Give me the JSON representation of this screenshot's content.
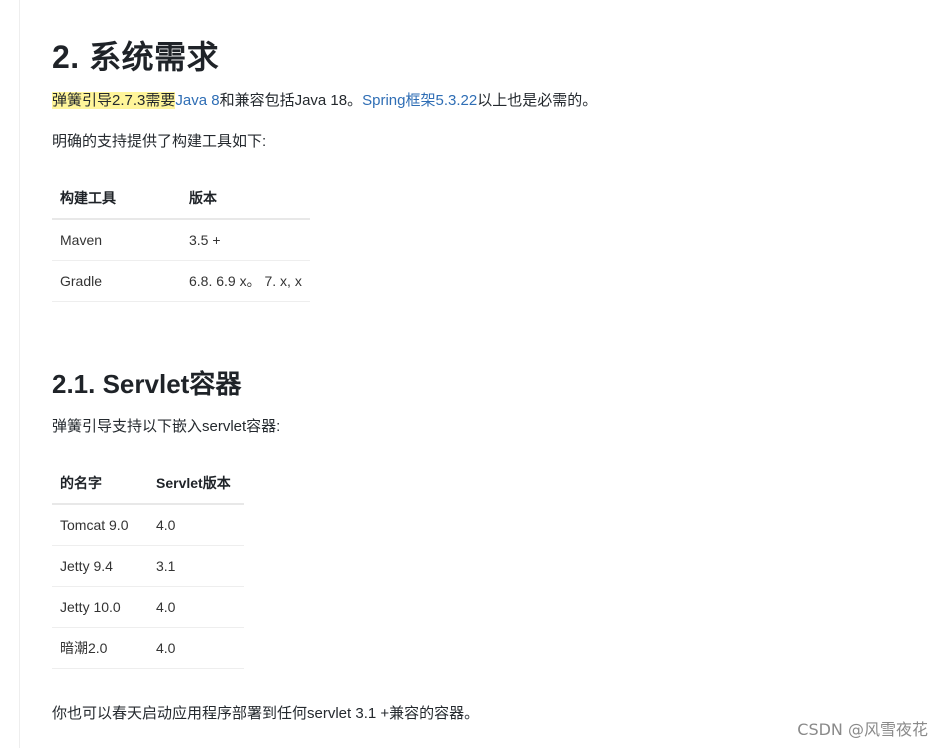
{
  "section": {
    "heading": "2. 系统需求",
    "p1": {
      "highlight": "弹簧引导2.7.3需要",
      "link1": "Java 8",
      "mid": "和兼容包括Java 18。",
      "link2": "Spring框架5.3.22",
      "end": "以上也是必需的。"
    },
    "p2": "明确的支持提供了构建工具如下:",
    "build_table": {
      "headers": [
        "构建工具",
        "版本"
      ],
      "rows": [
        [
          "Maven",
          "3.5 +"
        ],
        [
          "Gradle",
          "6.8. 6.9 x。 7. x, x"
        ]
      ]
    }
  },
  "subsection": {
    "heading": "2.1. Servlet容器",
    "p1": "弹簧引导支持以下嵌入servlet容器:",
    "servlet_table": {
      "headers": [
        "的名字",
        "Servlet版本"
      ],
      "rows": [
        [
          "Tomcat 9.0",
          "4.0"
        ],
        [
          "Jetty 9.4",
          "3.1"
        ],
        [
          "Jetty 10.0",
          "4.0"
        ],
        [
          "暗潮2.0",
          "4.0"
        ]
      ]
    },
    "p2": "你也可以春天启动应用程序部署到任何servlet 3.1 +兼容的容器。"
  },
  "watermark": "CSDN @风雪夜花"
}
